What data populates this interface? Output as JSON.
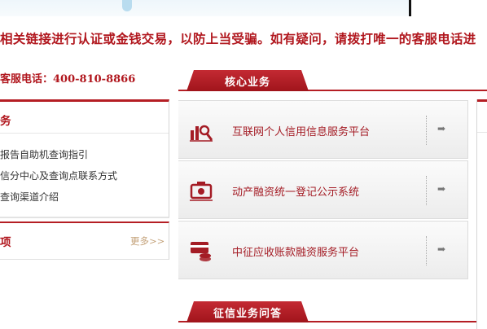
{
  "notice": "相关链接进行认证或金钱交易，以防上当受骗。如有疑问，请拨打唯一的客服电话进",
  "hotline": "客服电话：400-810-8866",
  "left_panel": {
    "title": "务",
    "links": [
      "报告自助机查询指引",
      "信分中心及查询点联系方式",
      "查询渠道介绍"
    ],
    "section2_title": "项",
    "more_label": "更多>>"
  },
  "core_business": {
    "heading": "核心业务",
    "items": [
      {
        "label": "互联网个人信用信息服务平台",
        "icon": "credit-chart-icon",
        "arrow": "➡"
      },
      {
        "label": "动产融资统一登记公示系统",
        "icon": "registration-icon",
        "arrow": "➡"
      },
      {
        "label": "中征应收账款融资服务平台",
        "icon": "receivables-card-icon",
        "arrow": "➡"
      }
    ]
  },
  "qa_heading": "征信业务问答",
  "colors": {
    "brand_red": "#b1171e"
  }
}
